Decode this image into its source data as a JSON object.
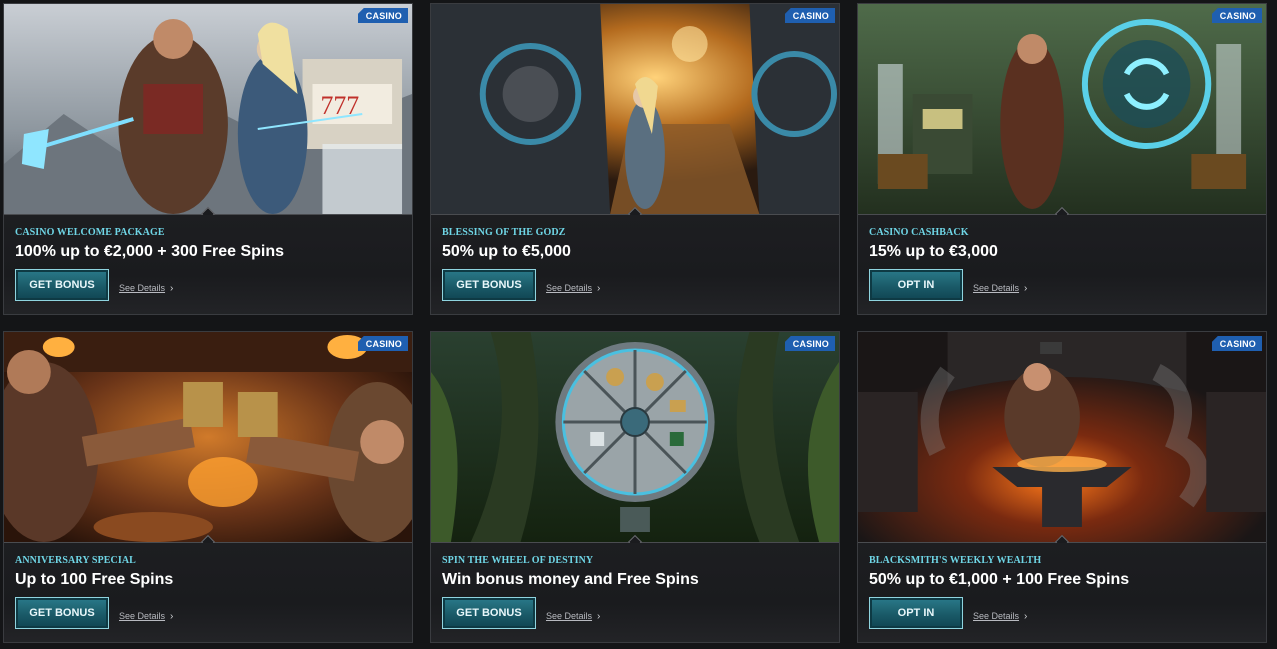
{
  "cards": [
    {
      "badge": "CASINO",
      "subtitle": "CASINO WELCOME PACKAGE",
      "headline": "100% up to €2,000 + 300 Free Spins",
      "button": "GET BONUS",
      "details": "See Details"
    },
    {
      "badge": "CASINO",
      "subtitle": "BLESSING OF THE GODZ",
      "headline": "50% up to €5,000",
      "button": "GET BONUS",
      "details": "See Details"
    },
    {
      "badge": "CASINO",
      "subtitle": "CASINO CASHBACK",
      "headline": "15% up to €3,000",
      "button": "OPT IN",
      "details": "See Details"
    },
    {
      "badge": "CASINO",
      "subtitle": "ANNIVERSARY SPECIAL",
      "headline": "Up to 100 Free Spins",
      "button": "GET BONUS",
      "details": "See Details"
    },
    {
      "badge": "CASINO",
      "subtitle": "SPIN THE WHEEL OF DESTINY",
      "headline": "Win bonus money and Free Spins",
      "button": "GET BONUS",
      "details": "See Details"
    },
    {
      "badge": "CASINO",
      "subtitle": "BLACKSMITH'S WEEKLY WEALTH",
      "headline": "50% up to €1,000 + 100 Free Spins",
      "button": "OPT IN",
      "details": "See Details"
    }
  ],
  "icons": {
    "chevron": "chevron-right-icon"
  },
  "colors": {
    "accent": "#6fd6e6",
    "badge": "#1f5fb0",
    "button": "#1a5a68"
  }
}
